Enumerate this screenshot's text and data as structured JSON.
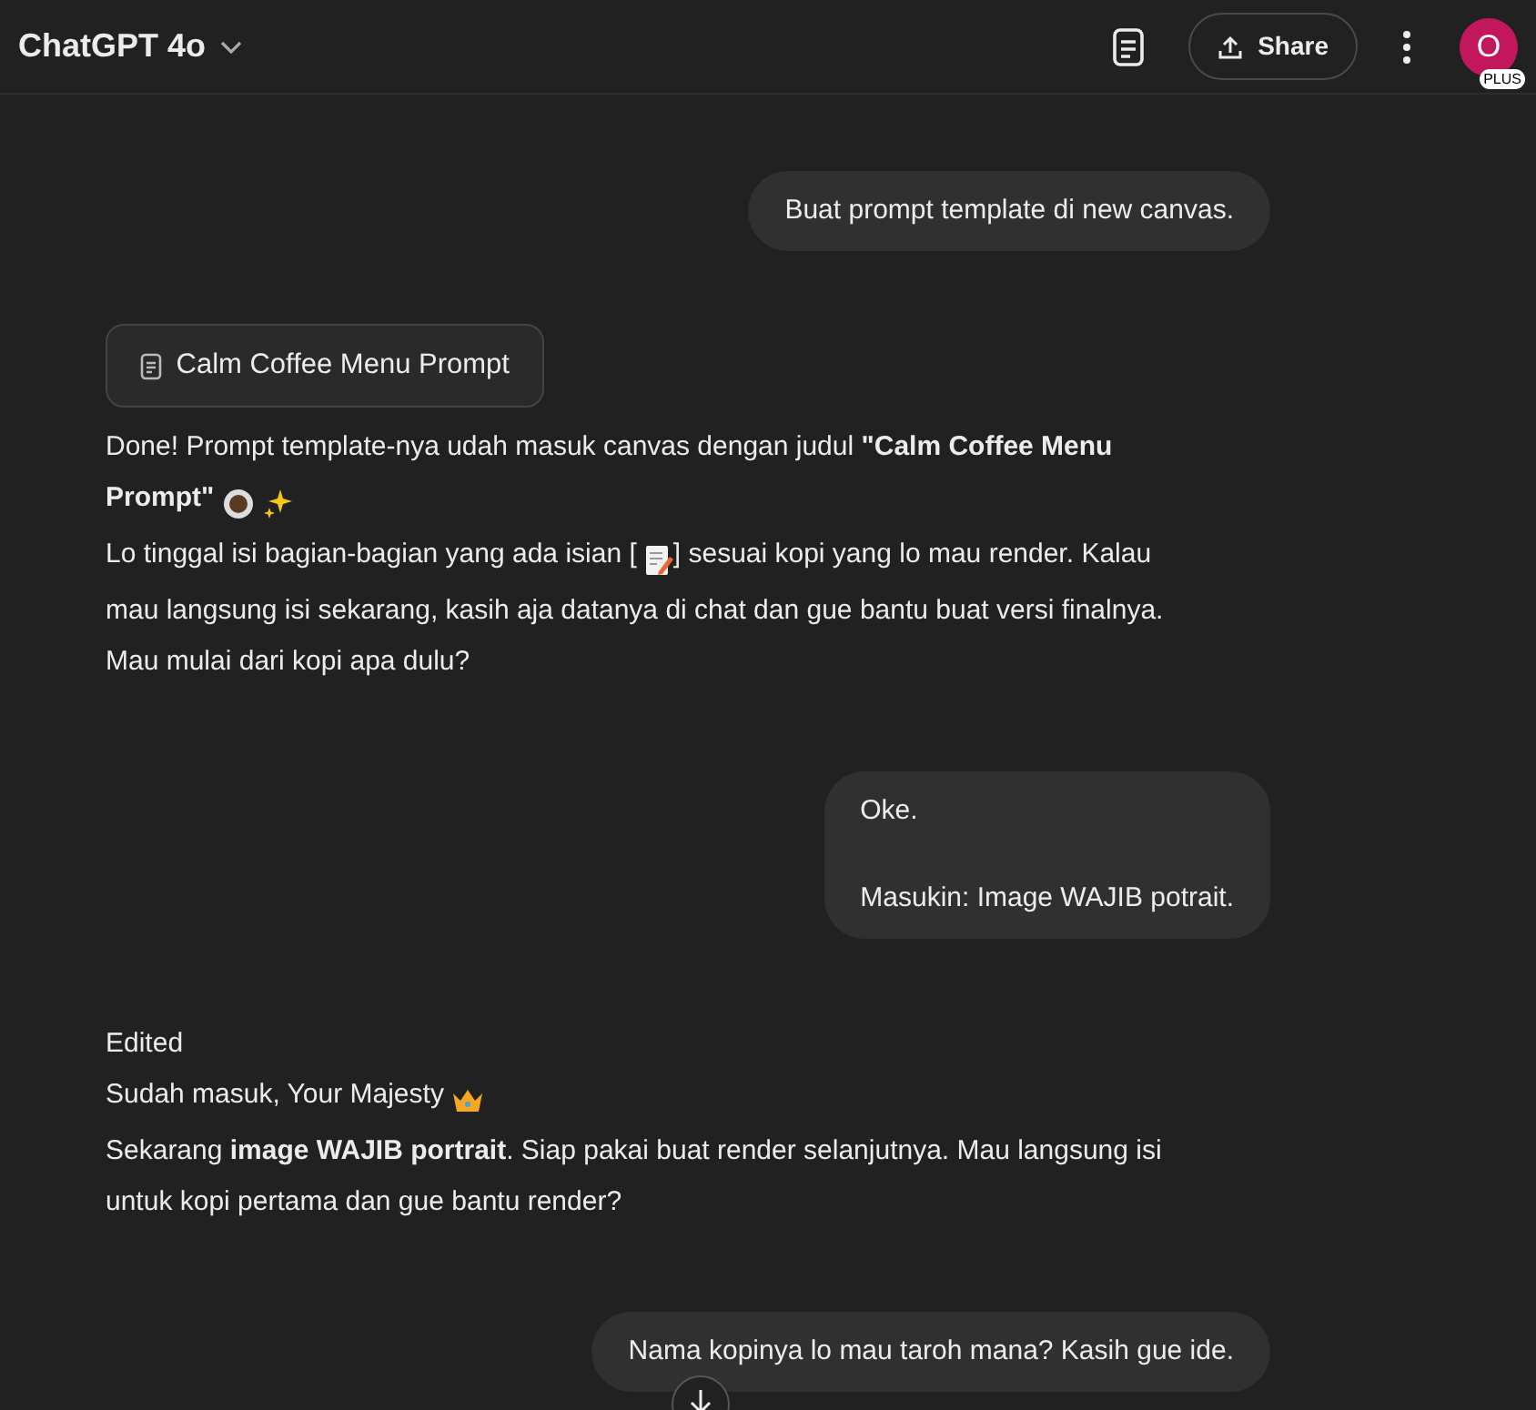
{
  "header": {
    "title": "ChatGPT 4o",
    "share": "Share",
    "avatar": "O",
    "plan": "PLUS"
  },
  "messages": [
    {
      "kind": "user",
      "lines": [
        "Buat prompt template di new canvas."
      ]
    },
    {
      "kind": "assistant",
      "canvas": "Calm Coffee Menu Prompt",
      "paragraphs": [
        [
          {
            "kind": "text",
            "text": "Done! Prompt template-nya udah masuk canvas dengan judul **\"Calm Coffee Menu**"
          }
        ],
        [
          {
            "kind": "text",
            "text": "**Prompt\"**"
          },
          {
            "kind": "cup"
          },
          {
            "kind": "sparkles"
          }
        ],
        [
          {
            "kind": "text",
            "text": "Lo tinggal isi bagian-bagian yang ada isian ["
          },
          {
            "kind": "memo"
          },
          {
            "kind": "text",
            "text": "] sesuai kopi yang lo mau render. Kalau"
          }
        ],
        [
          {
            "kind": "text",
            "text": "mau langsung isi sekarang, kasih aja datanya di chat dan gue bantu buat versi finalnya."
          }
        ],
        [
          {
            "kind": "text",
            "text": "Mau mulai dari kopi apa dulu?"
          }
        ]
      ]
    },
    {
      "kind": "user",
      "lines": [
        "Oke.",
        "Masukin: Image WAJIB potrait."
      ]
    },
    {
      "kind": "assistant",
      "paragraphs": [
        [
          {
            "kind": "text",
            "text": "Edited"
          }
        ],
        [
          {
            "kind": "text",
            "text": "Sudah masuk, Your Majesty"
          },
          {
            "kind": "crown"
          }
        ],
        [
          {
            "kind": "text",
            "text": "Sekarang **image WAJIB portrait**. Siap pakai buat render selanjutnya. Mau langsung isi"
          }
        ],
        [
          {
            "kind": "text",
            "text": "untuk kopi pertama dan gue bantu render?"
          }
        ]
      ]
    },
    {
      "kind": "user",
      "lines": [
        "Nama kopinya lo mau taroh mana? Kasih gue ide."
      ]
    }
  ]
}
